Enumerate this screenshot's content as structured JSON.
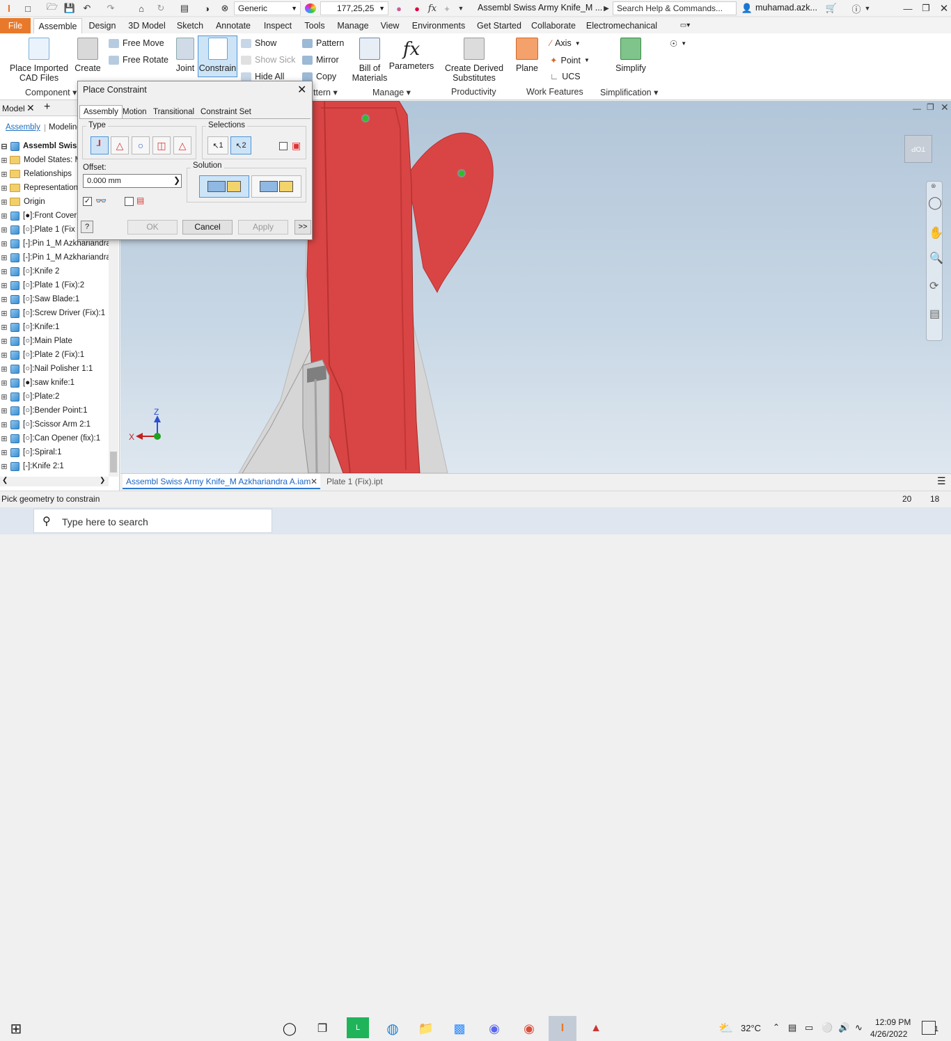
{
  "titlebar": {
    "material": "Generic",
    "color_value": "177,25,25",
    "doc_title": "Assembl Swiss Army Knife_M ...",
    "search_placeholder": "Search Help & Commands...",
    "user": "muhamad.azk..."
  },
  "ribbon_tabs": [
    "File",
    "Assemble",
    "Design",
    "3D Model",
    "Sketch",
    "Annotate",
    "Inspect",
    "Tools",
    "Manage",
    "View",
    "Environments",
    "Get Started",
    "Collaborate",
    "Electromechanical"
  ],
  "ribbon": {
    "place_imported": "Place Imported\nCAD Files",
    "create": "Create",
    "free_move": "Free Move",
    "free_rotate": "Free Rotate",
    "joint": "Joint",
    "constrain": "Constrain",
    "show": "Show",
    "show_sick": "Show Sick",
    "hide_all": "Hide All",
    "pattern": "Pattern",
    "mirror": "Mirror",
    "copy": "Copy",
    "bom": "Bill of\nMaterials",
    "parameters": "Parameters",
    "derived": "Create Derived\nSubstitutes",
    "plane": "Plane",
    "axis": "Axis",
    "point": "Point",
    "ucs": "UCS",
    "simplify": "Simplify",
    "panel_component": "Component",
    "panel_pattern": "ttern",
    "panel_manage": "Manage",
    "panel_productivity": "Productivity",
    "panel_workfeatures": "Work Features",
    "panel_simplification": "Simplification"
  },
  "browser": {
    "tab_model": "Model",
    "sub_assembly": "Assembly",
    "sub_modeling": "Modeling",
    "root": "Assembl Swiss A",
    "items": [
      {
        "label": "Model States: M",
        "icon": "folder"
      },
      {
        "label": "Relationships",
        "icon": "folder"
      },
      {
        "label": "Representation",
        "icon": "folder"
      },
      {
        "label": "Origin",
        "icon": "folder"
      },
      {
        "label": "[●]:Front Cover",
        "icon": "part"
      },
      {
        "label": "[○]:Plate 1 (Fix",
        "icon": "part"
      },
      {
        "label": "[-]:Pin 1_M Azkhariandra",
        "icon": "part"
      },
      {
        "label": "[-]:Pin 1_M Azkhariandra",
        "icon": "part"
      },
      {
        "label": "[○]:Knife 2",
        "icon": "part"
      },
      {
        "label": "[○]:Plate 1 (Fix):2",
        "icon": "part"
      },
      {
        "label": "[○]:Saw Blade:1",
        "icon": "part"
      },
      {
        "label": "[○]:Screw Driver (Fix):1",
        "icon": "part"
      },
      {
        "label": "[○]:Knife:1",
        "icon": "part"
      },
      {
        "label": "[○]:Main Plate",
        "icon": "part"
      },
      {
        "label": "[○]:Plate 2 (Fix):1",
        "icon": "part"
      },
      {
        "label": "[○]:Nail Polisher 1:1",
        "icon": "part"
      },
      {
        "label": "[●]:saw knife:1",
        "icon": "part"
      },
      {
        "label": "[○]:Plate:2",
        "icon": "part"
      },
      {
        "label": "[○]:Bender Point:1",
        "icon": "part"
      },
      {
        "label": "[○]:Scissor Arm 2:1",
        "icon": "part"
      },
      {
        "label": "[○]:Can Opener (fix):1",
        "icon": "part"
      },
      {
        "label": "[○]:Spiral:1",
        "icon": "part"
      },
      {
        "label": "[-]:Knife 2:1",
        "icon": "part"
      }
    ]
  },
  "dialog": {
    "title": "Place Constraint",
    "tabs": [
      "Assembly",
      "Motion",
      "Transitional",
      "Constraint Set"
    ],
    "type_label": "Type",
    "selections_label": "Selections",
    "sel1": "1",
    "sel2": "2",
    "offset_label": "Offset:",
    "offset_value": "0.000 mm",
    "solution_label": "Solution",
    "ok": "OK",
    "cancel": "Cancel",
    "apply": "Apply",
    "more": ">>"
  },
  "viewcube_label": "TOP",
  "axis_labels": {
    "x": "X",
    "z": "Z"
  },
  "doc_tabs": [
    "Assembl Swiss Army Knife_M Azkhariandra A.iam",
    "Plate 1 (Fix).ipt"
  ],
  "status": {
    "text": "Pick geometry to constrain",
    "n1": "20",
    "n2": "18"
  },
  "taskbar": {
    "search_placeholder": "Type here to search",
    "temperature": "32°C",
    "time": "12:09 PM",
    "date": "4/26/2022",
    "notifications": "1"
  },
  "colors": {
    "accent": "#e8792b",
    "part_red": "#d63d3d",
    "selection_blue": "#4f95d8"
  }
}
